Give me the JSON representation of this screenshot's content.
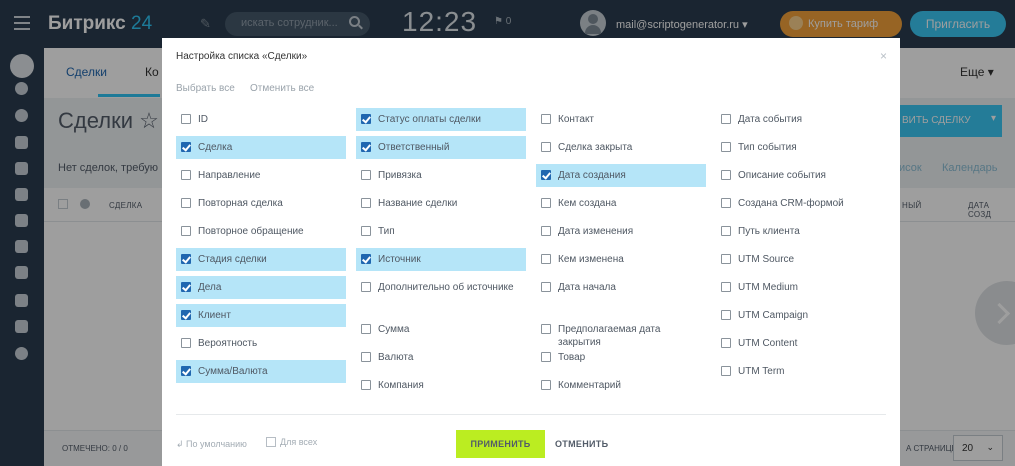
{
  "topbar": {
    "logo_text": "Битрикс",
    "logo_num": "24",
    "search_placeholder": "искать сотрудник...",
    "clock": "12:23",
    "notifications": "⚑ 0",
    "user_email": "mail@scriptogenerator.ru ▾",
    "buy_label": "Купить тариф",
    "invite_label": "Пригласить"
  },
  "crm": {
    "tabs": [
      "Сделки",
      "Ко",
      "Еще ▾"
    ],
    "page_title": "Сделки ☆",
    "add_deal": "ВИТЬ СДЕЛКУ",
    "filter_text": "Нет сделок, требую",
    "view_tabs": [
      "исок",
      "Календарь"
    ],
    "grid_cols": [
      "СДЕЛКА",
      "НЫЙ",
      "ДАТА СОЗД"
    ],
    "footer_left": "ОТМЕЧЕНО: 0 / 0",
    "per_page_label": "А СТРАНИЦЕ:",
    "per_page_value": "20"
  },
  "modal": {
    "title": "Настройка списка «Сделки»",
    "close": "×",
    "select_all": "Выбрать все",
    "deselect_all": "Отменить все",
    "columns": [
      [
        {
          "label": "ID",
          "checked": false
        },
        {
          "label": "Сделка",
          "checked": true
        },
        {
          "label": "Направление",
          "checked": false
        },
        {
          "label": "Повторная сделка",
          "checked": false
        },
        {
          "label": "Повторное обращение",
          "checked": false
        },
        {
          "label": "Стадия сделки",
          "checked": true
        },
        {
          "label": "Дела",
          "checked": true
        },
        {
          "label": "Клиент",
          "checked": true
        },
        {
          "label": "Вероятность",
          "checked": false
        },
        {
          "label": "Сумма/Валюта",
          "checked": true
        }
      ],
      [
        {
          "label": "Статус оплаты сделки",
          "checked": true
        },
        {
          "label": "Ответственный",
          "checked": true
        },
        {
          "label": "Привязка",
          "checked": false
        },
        {
          "label": "Название сделки",
          "checked": false
        },
        {
          "label": "Тип",
          "checked": false
        },
        {
          "label": "Источник",
          "checked": true
        },
        {
          "label": "Дополнительно об источнике",
          "checked": false
        },
        {
          "label": "Сумма",
          "checked": false
        },
        {
          "label": "Валюта",
          "checked": false
        },
        {
          "label": "Компания",
          "checked": false
        }
      ],
      [
        {
          "label": "Контакт",
          "checked": false
        },
        {
          "label": "Сделка закрыта",
          "checked": false
        },
        {
          "label": "Дата создания",
          "checked": true
        },
        {
          "label": "Кем создана",
          "checked": false
        },
        {
          "label": "Дата изменения",
          "checked": false
        },
        {
          "label": "Кем изменена",
          "checked": false
        },
        {
          "label": "Дата начала",
          "checked": false
        },
        {
          "label": "Предполагаемая дата закрытия",
          "checked": false
        },
        {
          "label": "Товар",
          "checked": false
        },
        {
          "label": "Комментарий",
          "checked": false
        }
      ],
      [
        {
          "label": "Дата события",
          "checked": false
        },
        {
          "label": "Тип события",
          "checked": false
        },
        {
          "label": "Описание события",
          "checked": false
        },
        {
          "label": "Создана CRM-формой",
          "checked": false
        },
        {
          "label": "Путь клиента",
          "checked": false
        },
        {
          "label": "UTM Source",
          "checked": false
        },
        {
          "label": "UTM Medium",
          "checked": false
        },
        {
          "label": "UTM Campaign",
          "checked": false
        },
        {
          "label": "UTM Content",
          "checked": false
        },
        {
          "label": "UTM Term",
          "checked": false
        }
      ]
    ],
    "default_link": "↲ По умолчанию",
    "all_users": "Для всех",
    "apply": "ПРИМЕНИТЬ",
    "cancel": "ОТМЕНИТЬ"
  }
}
